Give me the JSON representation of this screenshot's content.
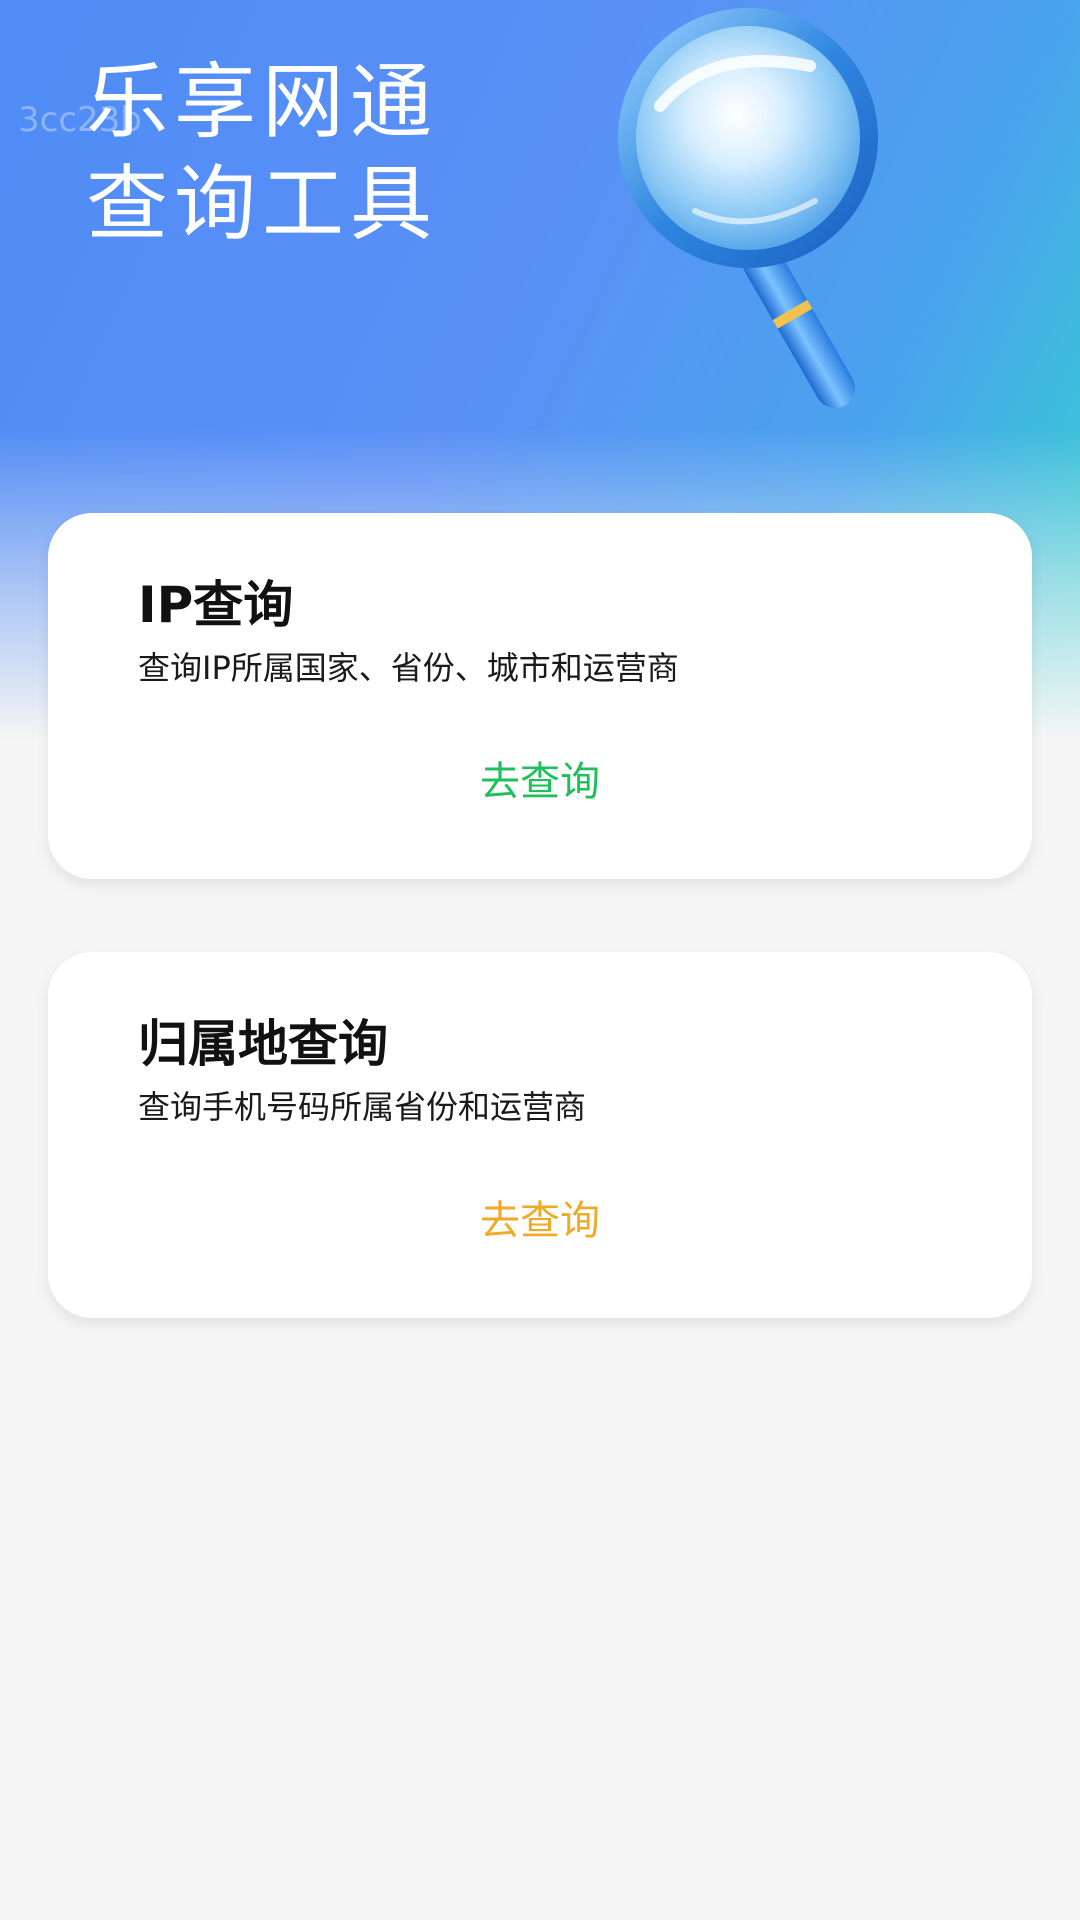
{
  "header": {
    "watermark": "3cc23b",
    "title_line1": "乐享网通",
    "title_line2": "查询工具",
    "illustration_icon": "magnifying-glass-icon"
  },
  "cards": [
    {
      "title": "IP查询",
      "description": "查询IP所属国家、省份、城市和运营商",
      "action_label": "去查询",
      "action_color": "#1fbf5a"
    },
    {
      "title": "归属地查询",
      "description": "查询手机号码所属省份和运营商",
      "action_label": "去查询",
      "action_color": "#f0aa2a"
    }
  ],
  "colors": {
    "header_gradient_start": "#4f8cf5",
    "header_gradient_end": "#33d3cc",
    "background": "#f5f5f5"
  }
}
